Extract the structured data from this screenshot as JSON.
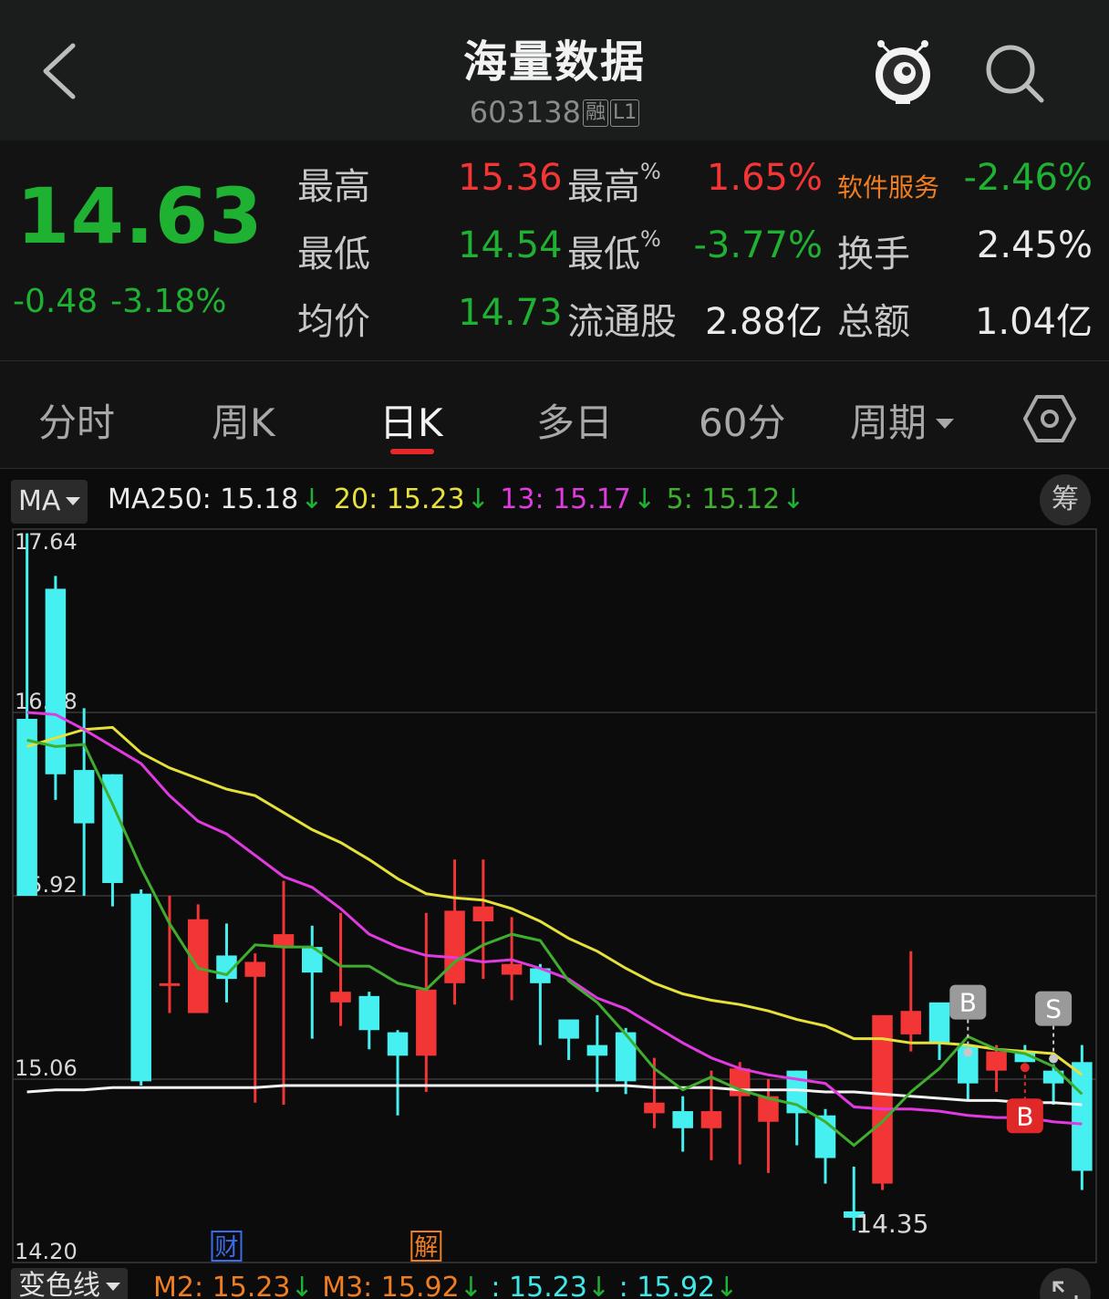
{
  "header": {
    "title": "海量数据",
    "code": "603138",
    "tag_rong": "融",
    "tag_l1": "L1"
  },
  "quote": {
    "price": "14.63",
    "change": "-0.48",
    "change_pct": "-3.18%",
    "rows": [
      {
        "label1": "最高",
        "value1": "15.36",
        "label2": "最高",
        "sup2": "%",
        "value2": "1.65%",
        "label3": "软件服务",
        "value3": "-2.46%"
      },
      {
        "label1": "最低",
        "value1": "14.54",
        "label2": "最低",
        "sup2": "%",
        "value2": "-3.77%",
        "label3": "换手",
        "value3": "2.45%"
      },
      {
        "label1": "均价",
        "value1": "14.73",
        "label2": "流通股",
        "sup2": "",
        "value2": "2.88亿",
        "label3": "总额",
        "value3": "1.04亿"
      }
    ]
  },
  "tabs": [
    {
      "label": "分时"
    },
    {
      "label": "周K"
    },
    {
      "label": "日K",
      "active": true
    },
    {
      "label": "多日"
    },
    {
      "label": "60分"
    },
    {
      "label": "周期"
    }
  ],
  "ma": {
    "button": "MA",
    "items": [
      {
        "label": "MA250: 15.18",
        "color": "#eaeaea"
      },
      {
        "label": "20: 15.23",
        "color": "#e6e03a"
      },
      {
        "label": "13: 15.17",
        "color": "#e03ae0"
      },
      {
        "label": "5: 15.12",
        "color": "#3fae2e"
      }
    ],
    "arrow": "↓",
    "chou": "筹"
  },
  "bottom": {
    "button": "变色线",
    "items": [
      {
        "label": "M2: 15.23",
        "color": "#f07e20"
      },
      {
        "label": "M3: 15.92",
        "color": "#f07e20"
      },
      {
        "label": ": 15.23",
        "color": "#3ee8e8"
      },
      {
        "label": ": 15.92",
        "color": "#3ee8e8"
      }
    ],
    "arrow": "↓"
  },
  "chart_data": {
    "type": "candlestick",
    "y_ticks": [
      "17.64",
      "16.78",
      "15.92",
      "15.06",
      "14.20"
    ],
    "ylim": [
      14.2,
      17.64
    ],
    "low_label": "14.35",
    "event_markers": [
      {
        "label": "财",
        "index": 7
      },
      {
        "label": "解",
        "index": 14
      }
    ],
    "trade_markers": [
      {
        "label": "B",
        "index": 33,
        "color": "#9a9a9a"
      },
      {
        "label": "S",
        "index": 36,
        "color": "#9a9a9a"
      },
      {
        "label": "B",
        "index": 35,
        "color": "#e02828"
      }
    ],
    "colors": {
      "up": "#f23535",
      "down": "#46f0f0",
      "ma5": "#3fae2e",
      "ma13": "#e03ae0",
      "ma20": "#e6e03a",
      "ma250": "#f2f2f2"
    },
    "candles": [
      {
        "o": 16.75,
        "c": 15.92,
        "h": 17.62,
        "l": 15.92
      },
      {
        "o": 17.36,
        "c": 16.49,
        "h": 17.42,
        "l": 16.37
      },
      {
        "o": 16.51,
        "c": 16.26,
        "h": 16.8,
        "l": 15.92
      },
      {
        "o": 16.49,
        "c": 15.98,
        "h": 16.49,
        "l": 15.87
      },
      {
        "o": 15.93,
        "c": 15.05,
        "h": 15.95,
        "l": 15.03
      },
      {
        "o": 15.5,
        "c": 15.51,
        "h": 15.92,
        "l": 15.37
      },
      {
        "o": 15.37,
        "c": 15.81,
        "h": 15.88,
        "l": 15.37
      },
      {
        "o": 15.64,
        "c": 15.53,
        "h": 15.79,
        "l": 15.42
      },
      {
        "o": 15.54,
        "c": 15.61,
        "h": 15.65,
        "l": 14.95
      },
      {
        "o": 15.68,
        "c": 15.74,
        "h": 15.99,
        "l": 14.94
      },
      {
        "o": 15.68,
        "c": 15.56,
        "h": 15.78,
        "l": 15.25
      },
      {
        "o": 15.42,
        "c": 15.47,
        "h": 15.84,
        "l": 15.31
      },
      {
        "o": 15.45,
        "c": 15.29,
        "h": 15.47,
        "l": 15.2
      },
      {
        "o": 15.28,
        "c": 15.17,
        "h": 15.29,
        "l": 14.89
      },
      {
        "o": 15.17,
        "c": 15.48,
        "h": 15.84,
        "l": 15.0
      },
      {
        "o": 15.51,
        "c": 15.85,
        "h": 16.09,
        "l": 15.41
      },
      {
        "o": 15.8,
        "c": 15.87,
        "h": 16.09,
        "l": 15.53
      },
      {
        "o": 15.55,
        "c": 15.6,
        "h": 15.82,
        "l": 15.43
      },
      {
        "o": 15.58,
        "c": 15.51,
        "h": 15.6,
        "l": 15.22
      },
      {
        "o": 15.34,
        "c": 15.25,
        "h": 15.34,
        "l": 15.15
      },
      {
        "o": 15.22,
        "c": 15.17,
        "h": 15.36,
        "l": 15.0
      },
      {
        "o": 15.28,
        "c": 15.05,
        "h": 15.3,
        "l": 14.99
      },
      {
        "o": 14.9,
        "c": 14.95,
        "h": 15.16,
        "l": 14.83
      },
      {
        "o": 14.91,
        "c": 14.83,
        "h": 14.98,
        "l": 14.72
      },
      {
        "o": 14.83,
        "c": 14.91,
        "h": 15.1,
        "l": 14.68
      },
      {
        "o": 14.98,
        "c": 15.11,
        "h": 15.14,
        "l": 14.66
      },
      {
        "o": 14.86,
        "c": 14.98,
        "h": 15.06,
        "l": 14.62
      },
      {
        "o": 15.1,
        "c": 14.9,
        "h": 15.1,
        "l": 14.75
      },
      {
        "o": 14.89,
        "c": 14.69,
        "h": 14.92,
        "l": 14.57
      },
      {
        "o": 14.44,
        "c": 14.41,
        "h": 14.65,
        "l": 14.35
      },
      {
        "o": 14.57,
        "c": 15.36,
        "h": 15.36,
        "l": 14.54
      },
      {
        "o": 15.27,
        "c": 15.38,
        "h": 15.66,
        "l": 15.19
      },
      {
        "o": 15.42,
        "c": 15.23,
        "h": 15.41,
        "l": 15.15
      },
      {
        "o": 15.22,
        "c": 15.04,
        "h": 15.16,
        "l": 14.96
      },
      {
        "o": 15.1,
        "c": 15.19,
        "h": 15.22,
        "l": 15.0
      },
      {
        "o": 15.19,
        "c": 15.14,
        "h": 15.22,
        "l": 15.14
      },
      {
        "o": 15.1,
        "c": 15.04,
        "h": 15.13,
        "l": 14.94
      },
      {
        "o": 15.14,
        "c": 14.63,
        "h": 15.22,
        "l": 14.54
      }
    ],
    "ma5": [
      16.65,
      16.62,
      16.63,
      16.35,
      16.05,
      15.79,
      15.58,
      15.55,
      15.69,
      15.68,
      15.68,
      15.59,
      15.59,
      15.51,
      15.48,
      15.61,
      15.69,
      15.74,
      15.71,
      15.52,
      15.42,
      15.27,
      15.11,
      15.01,
      15.07,
      15.01,
      14.97,
      14.94,
      14.86,
      14.75,
      14.86,
      15.0,
      15.11,
      15.26,
      15.2,
      15.18,
      15.12,
      14.99
    ],
    "ma13": [
      16.78,
      16.77,
      16.7,
      16.62,
      16.54,
      16.39,
      16.27,
      16.21,
      16.11,
      16.01,
      15.96,
      15.86,
      15.74,
      15.68,
      15.64,
      15.63,
      15.61,
      15.62,
      15.58,
      15.53,
      15.44,
      15.39,
      15.31,
      15.23,
      15.16,
      15.11,
      15.08,
      15.06,
      15.04,
      14.93,
      14.92,
      14.92,
      14.91,
      14.89,
      14.88,
      14.88,
      14.86,
      14.85
    ],
    "ma20": [
      16.62,
      16.66,
      16.7,
      16.71,
      16.59,
      16.52,
      16.47,
      16.42,
      16.39,
      16.31,
      16.23,
      16.17,
      16.09,
      16.0,
      15.93,
      15.91,
      15.9,
      15.86,
      15.8,
      15.72,
      15.66,
      15.58,
      15.51,
      15.46,
      15.43,
      15.41,
      15.38,
      15.34,
      15.31,
      15.25,
      15.25,
      15.23,
      15.23,
      15.22,
      15.2,
      15.19,
      15.18,
      15.08
    ],
    "ma250": [
      15.0,
      15.01,
      15.01,
      15.02,
      15.02,
      15.02,
      15.02,
      15.02,
      15.02,
      15.03,
      15.03,
      15.03,
      15.03,
      15.03,
      15.03,
      15.03,
      15.03,
      15.03,
      15.03,
      15.03,
      15.03,
      15.03,
      15.02,
      15.02,
      15.02,
      15.01,
      15.01,
      15.01,
      15.0,
      15.0,
      14.99,
      14.98,
      14.97,
      14.96,
      14.96,
      14.95,
      14.95,
      14.94
    ]
  }
}
